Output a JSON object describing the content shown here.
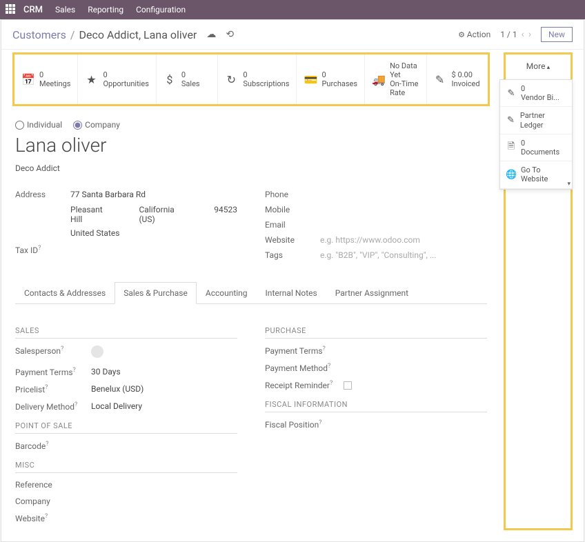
{
  "topbar": {
    "brand": "CRM",
    "nav": [
      "Sales",
      "Reporting",
      "Configuration"
    ]
  },
  "header": {
    "breadcrumb_root": "Customers",
    "breadcrumb_current": "Deco Addict, Lana oliver",
    "action": "Action",
    "pager": "1 / 1",
    "new_btn": "New"
  },
  "stats": [
    {
      "icon": "📅",
      "value": "0",
      "label": "Meetings"
    },
    {
      "icon": "★",
      "value": "0",
      "label": "Opportunities"
    },
    {
      "icon": "$",
      "value": "0",
      "label": "Sales"
    },
    {
      "icon": "↻",
      "value": "0",
      "label": "Subscriptions"
    },
    {
      "icon": "💳",
      "value": "0",
      "label": "Purchases"
    },
    {
      "icon": "🚚",
      "value": "No Data Yet",
      "label": "On-Time Rate"
    },
    {
      "icon": "✎",
      "value": "$ 0.00",
      "label": "Invoiced"
    }
  ],
  "more": {
    "label": "More",
    "items": [
      {
        "icon": "✎",
        "value": "0",
        "label": "Vendor Bi..."
      },
      {
        "icon": "✎",
        "value": "",
        "label": "Partner Ledger"
      },
      {
        "icon": "🗎",
        "value": "0",
        "label": "Documents"
      },
      {
        "icon": "🌐",
        "value": "",
        "label": "Go To Website"
      }
    ]
  },
  "form": {
    "individual": "Individual",
    "company": "Company",
    "name": "Lana oliver",
    "company_name": "Deco Addict",
    "address_label": "Address",
    "street": "77 Santa Barbara Rd",
    "city": "Pleasant Hill",
    "state": "California (US)",
    "zip": "94523",
    "country": "United States",
    "taxid_label": "Tax ID",
    "phone_label": "Phone",
    "mobile_label": "Mobile",
    "email_label": "Email",
    "website_label": "Website",
    "website_ph": "e.g. https://www.odoo.com",
    "tags_label": "Tags",
    "tags_ph": "e.g. \"B2B\", \"VIP\", \"Consulting\", ..."
  },
  "tabs": [
    "Contacts & Addresses",
    "Sales & Purchase",
    "Accounting",
    "Internal Notes",
    "Partner Assignment"
  ],
  "sections": {
    "sales": {
      "title": "SALES",
      "rows": [
        {
          "label": "Salesperson",
          "value": ""
        },
        {
          "label": "Payment Terms",
          "value": "30 Days"
        },
        {
          "label": "Pricelist",
          "value": "Benelux (USD)"
        },
        {
          "label": "Delivery Method",
          "value": "Local Delivery"
        }
      ]
    },
    "purchase": {
      "title": "PURCHASE",
      "rows": [
        {
          "label": "Payment Terms",
          "value": ""
        },
        {
          "label": "Payment Method",
          "value": ""
        },
        {
          "label": "Receipt Reminder",
          "value": ""
        }
      ]
    },
    "pos": {
      "title": "POINT OF SALE",
      "rows": [
        {
          "label": "Barcode",
          "value": ""
        }
      ]
    },
    "fiscal": {
      "title": "FISCAL INFORMATION",
      "rows": [
        {
          "label": "Fiscal Position",
          "value": ""
        }
      ]
    },
    "misc": {
      "title": "MISC",
      "rows": [
        {
          "label": "Reference",
          "value": ""
        },
        {
          "label": "Company",
          "value": ""
        },
        {
          "label": "Website",
          "value": ""
        }
      ]
    }
  }
}
